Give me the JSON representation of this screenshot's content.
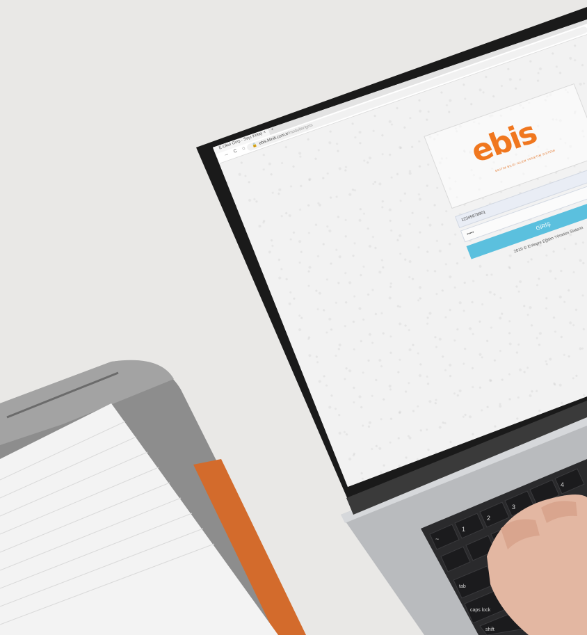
{
  "browser": {
    "tab_title": "E-Okul Giriş - Sayı Kolay",
    "tab_close": "×",
    "new_tab": "+",
    "nav": {
      "back": "←",
      "forward": "→",
      "reload": "C",
      "home": "⌂"
    },
    "address": {
      "lock": "🔒",
      "host": "ebis.klinik.com.tr",
      "path": "/moduller/giris"
    }
  },
  "login": {
    "logo_text": "ebis",
    "logo_subtitle": "EGITIM BILGI ISLEM YONETIM SISTEMI",
    "username_value": "12345678901",
    "password_value": "•••••",
    "submit_label": "GİRİŞ",
    "footer": "2019 © Entegre Eğitim Yönetim Sistemi"
  },
  "taskbar": {
    "start_icon": "⊞",
    "search_icon": "⌕"
  },
  "keyboard": {
    "keys": [
      "~",
      "!",
      "@",
      "#",
      "$",
      "%",
      "1",
      "2",
      "3",
      "4",
      "tab",
      "caps lock",
      "shift"
    ]
  },
  "colors": {
    "brand_orange": "#f0771f",
    "button_blue": "#5bc0de",
    "desk": "#e9e8e6",
    "laptop_bezel": "#1a1a1a",
    "laptop_body": "#b9bbbe",
    "bag_gray": "#8a8a8a",
    "bag_strap_orange": "#d36b2c",
    "notebook_paper": "#f3f3f3"
  }
}
